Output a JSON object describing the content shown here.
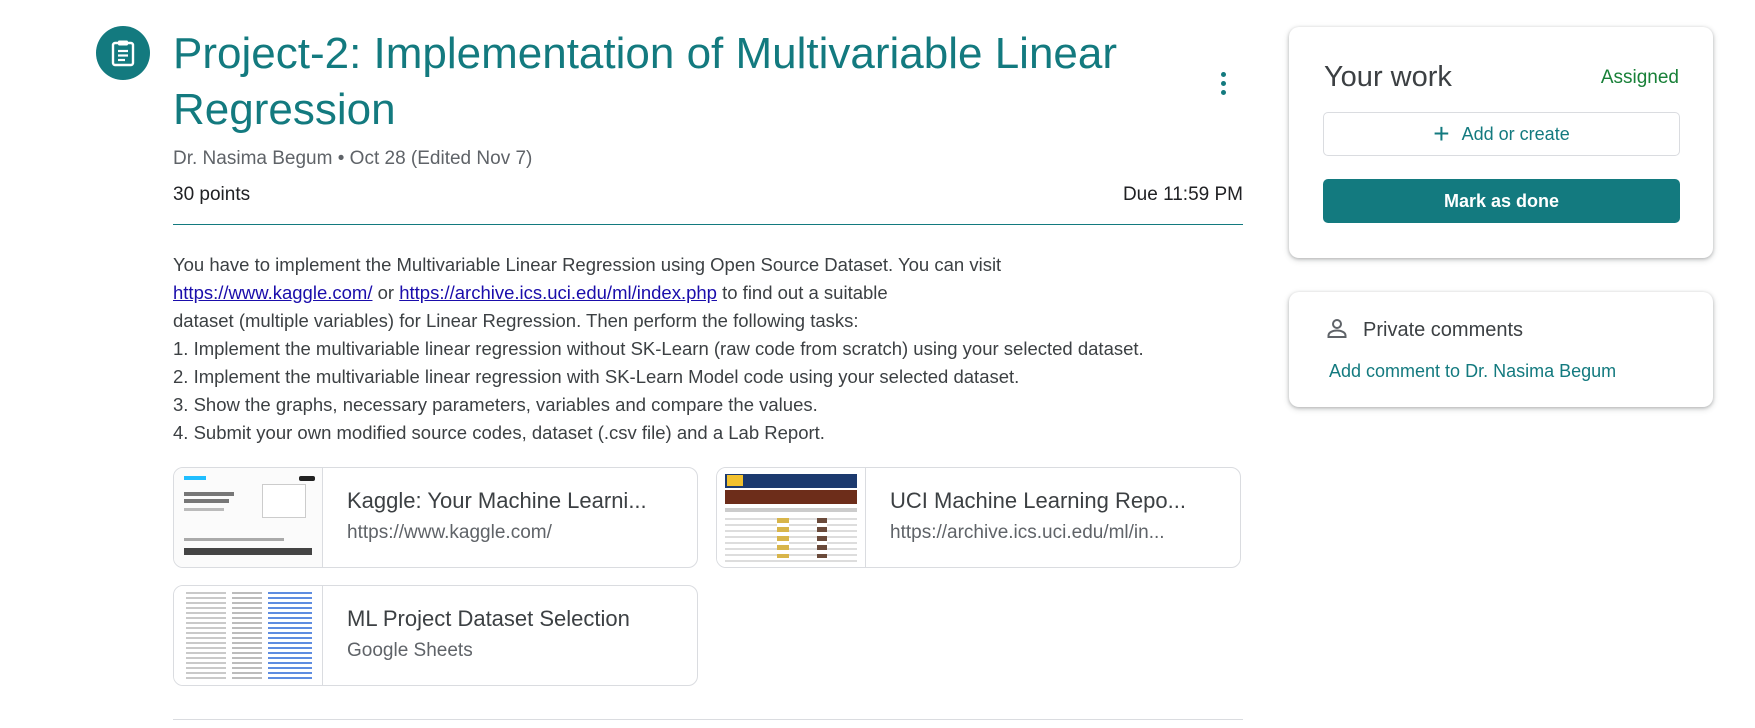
{
  "assignment": {
    "title": "Project-2: Implementation of Multivariable Linear Regression",
    "author": "Dr. Nasima Begum",
    "separator": "•",
    "date": "Oct 28 (Edited Nov 7)",
    "points": "30 points",
    "due": "Due 11:59 PM",
    "description": {
      "line1": "You have to implement the Multivariable Linear Regression using Open Source Dataset. You can visit",
      "link1": "https://www.kaggle.com/",
      "or_text": " or ",
      "link2": "https://archive.ics.uci.edu/ml/index.php",
      "line2_tail": " to find out a suitable",
      "line3": "dataset (multiple variables) for Linear Regression. Then perform the following tasks:",
      "task1": "1. Implement the multivariable linear regression without SK-Learn (raw code from scratch) using your selected dataset.",
      "task2": "2. Implement the multivariable linear regression with SK-Learn Model code using your selected dataset.",
      "task3": "3. Show the graphs, necessary parameters, variables and compare the values.",
      "task4": "4. Submit your own modified source codes, dataset (.csv file) and a Lab Report."
    },
    "attachments": [
      {
        "title": "Kaggle: Your Machine Learni...",
        "subtitle": "https://www.kaggle.com/",
        "thumbnail": "kaggle-page-thumbnail"
      },
      {
        "title": "UCI Machine Learning Repo...",
        "subtitle": "https://archive.ics.uci.edu/ml/in...",
        "thumbnail": "uci-page-thumbnail"
      },
      {
        "title": "ML Project Dataset Selection",
        "subtitle": "Google Sheets",
        "thumbnail": "sheet-thumbnail"
      }
    ]
  },
  "your_work": {
    "title": "Your work",
    "status": "Assigned",
    "add_label": "Add or create",
    "mark_done_label": "Mark as done"
  },
  "private_comments": {
    "title": "Private comments",
    "add_label": "Add comment to Dr. Nasima Begum"
  },
  "icons": {
    "assignment": "assignment-icon",
    "more": "more-vert-icon",
    "add": "plus-icon",
    "person": "person-icon"
  },
  "colors": {
    "accent": "#137a7f",
    "status_green": "#188038",
    "link_blue": "#1a0dab"
  }
}
